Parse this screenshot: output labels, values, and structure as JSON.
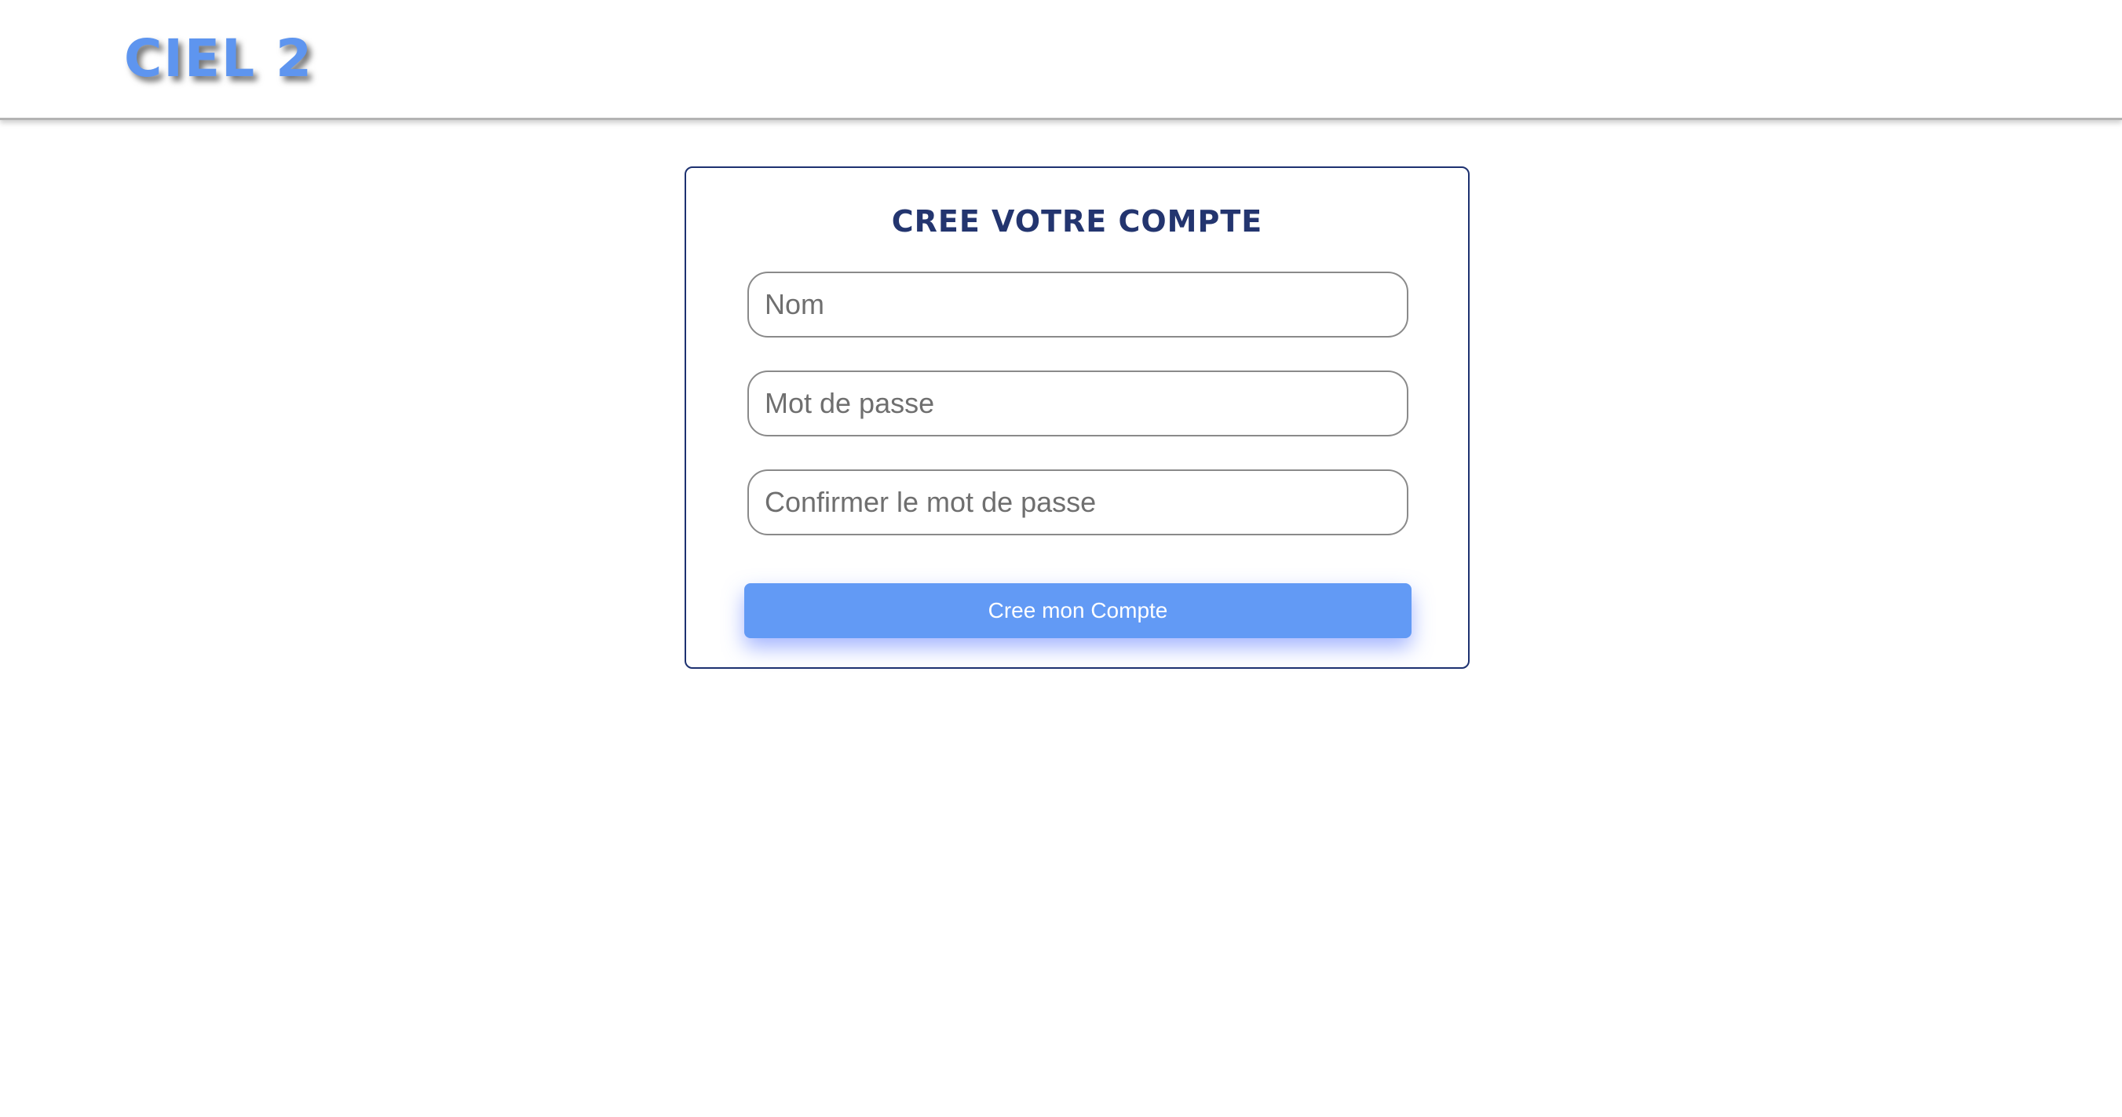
{
  "header": {
    "logo_text": "CIEL 2"
  },
  "form": {
    "title": "CREE VOTRE COMPTE",
    "fields": [
      {
        "placeholder": "Nom",
        "value": ""
      },
      {
        "placeholder": "Mot de passe",
        "value": ""
      },
      {
        "placeholder": "Confirmer le mot de passe",
        "value": ""
      }
    ],
    "submit_label": "Cree mon Compte"
  },
  "colors": {
    "logo": "#5e95ef",
    "title": "#23356f",
    "card_border": "#1d3170",
    "button": "#629af5",
    "button_text": "#ffffff"
  }
}
